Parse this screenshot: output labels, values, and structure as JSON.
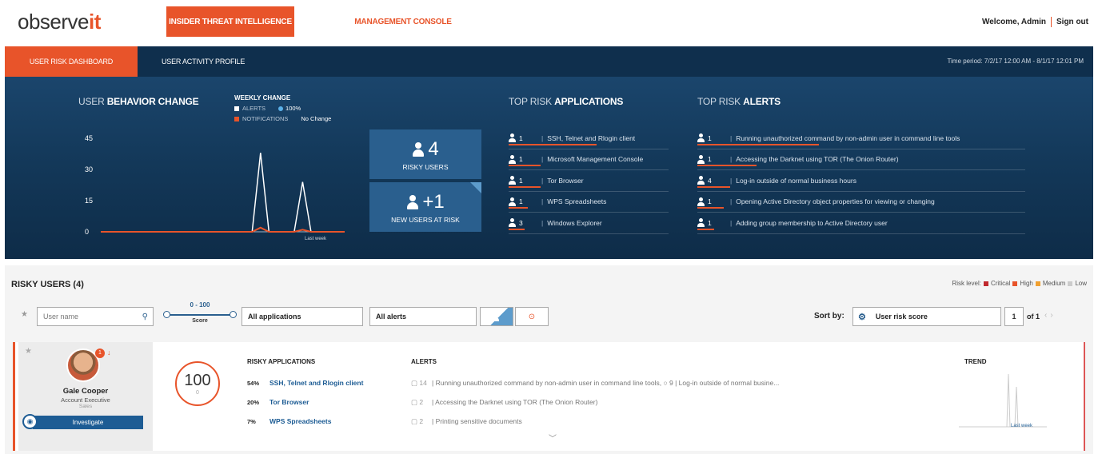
{
  "logo": {
    "text": "observe",
    "accent": "it"
  },
  "topnav": {
    "active": "INSIDER THREAT INTELLIGENCE",
    "inactive": "MANAGEMENT CONSOLE"
  },
  "user_menu": {
    "welcome": "Welcome, Admin",
    "signout": "Sign out"
  },
  "subnav": {
    "active": "USER RISK DASHBOARD",
    "inactive": "USER ACTIVITY PROFILE",
    "time_period": "Time period: 7/2/17 12:00 AM - 8/1/17 12:01 PM"
  },
  "behavior": {
    "title_light": "USER ",
    "title_bold": "BEHAVIOR CHANGE",
    "weekly_title": "WEEKLY CHANGE",
    "alerts_label": "ALERTS",
    "alerts_value": "100%",
    "notif_label": "NOTIFICATIONS",
    "notif_value": "No Change",
    "y_ticks": [
      "45",
      "30",
      "15",
      "0"
    ],
    "x_label": "Last week"
  },
  "chart_data": {
    "type": "line",
    "ylim": [
      0,
      45
    ],
    "yticks": [
      0,
      15,
      30,
      45
    ],
    "series": [
      {
        "values": [
          0,
          0,
          0,
          0,
          0,
          0,
          0,
          0,
          0,
          0,
          0,
          0,
          0,
          0,
          0,
          0,
          0,
          0,
          0,
          38,
          0,
          0,
          0,
          0,
          24,
          0,
          0,
          0,
          0,
          0
        ]
      },
      {
        "values": [
          0,
          0,
          0,
          0,
          0,
          0,
          0,
          0,
          0,
          0,
          0,
          0,
          0,
          0,
          0,
          0,
          0,
          0,
          0,
          2,
          0,
          0,
          0,
          0,
          1,
          0,
          0,
          0,
          0,
          0
        ]
      }
    ]
  },
  "stats": [
    {
      "value": "4",
      "label": "RISKY USERS"
    },
    {
      "value": "+1",
      "label": "NEW USERS AT RISK"
    }
  ],
  "top_apps": {
    "title_light": "TOP RISK ",
    "title_bold": "APPLICATIONS",
    "items": [
      {
        "count": "1",
        "name": "SSH, Telnet and Rlogin client",
        "bar": 0.55
      },
      {
        "count": "1",
        "name": "Microsoft Management Console",
        "bar": 0.2
      },
      {
        "count": "1",
        "name": "Tor Browser",
        "bar": 0.2
      },
      {
        "count": "1",
        "name": "WPS Spreadsheets",
        "bar": 0.12
      },
      {
        "count": "3",
        "name": "Windows Explorer",
        "bar": 0.1
      }
    ]
  },
  "top_alerts": {
    "title_light": "TOP RISK ",
    "title_bold": "ALERTS",
    "items": [
      {
        "count": "1",
        "name": "Running unauthorized command by non-admin user in command line tools",
        "bar": 0.37
      },
      {
        "count": "1",
        "name": "Accessing the Darknet using TOR (The Onion Router)",
        "bar": 0.18
      },
      {
        "count": "4",
        "name": "Log-in outside of normal business hours",
        "bar": 0.1
      },
      {
        "count": "1",
        "name": "Opening Active Directory object properties for viewing or changing",
        "bar": 0.08
      },
      {
        "count": "1",
        "name": "Adding group membership to Active Directory user",
        "bar": 0.05
      }
    ]
  },
  "risky": {
    "title": "RISKY USERS (4)",
    "legend_label": "Risk level:",
    "legend": [
      {
        "name": "Critical",
        "color": "#c0282d"
      },
      {
        "name": "High",
        "color": "#e8542a"
      },
      {
        "name": "Medium",
        "color": "#f0a030"
      },
      {
        "name": "Low",
        "color": "#cccccc"
      }
    ]
  },
  "filters": {
    "user_placeholder": "User name",
    "score_range": "0 - 100",
    "score_label": "Score",
    "apps": "All applications",
    "alerts": "All alerts",
    "sort_label": "Sort by:",
    "sort_value": "User risk score",
    "page": "1",
    "of": "of 1"
  },
  "user_card": {
    "badge": "1",
    "name": "Gale Cooper",
    "title": "Account Executive",
    "dept": "Sales",
    "investigate": "Investigate",
    "score": "100",
    "score_sub": "0",
    "apps_header": "RISKY APPLICATIONS",
    "apps": [
      {
        "pct": "54%",
        "name": "SSH, Telnet and Rlogin client"
      },
      {
        "pct": "20%",
        "name": "Tor Browser"
      },
      {
        "pct": "7%",
        "name": "WPS Spreadsheets"
      }
    ],
    "alerts_header": "ALERTS",
    "alerts": [
      {
        "count": "14",
        "text": "Running unauthorized command by non-admin user in command line tools, ○ 9 | Log-in outside of normal busine..."
      },
      {
        "count": "2",
        "text": "Accessing the Darknet using TOR (The Onion Router)"
      },
      {
        "count": "2",
        "text": "Printing sensitive documents"
      }
    ],
    "trend_header": "TREND",
    "trend_label": "Last week"
  },
  "colors": {
    "accent": "#e8542a",
    "navy": "#133859",
    "blue": "#1d5c94"
  }
}
